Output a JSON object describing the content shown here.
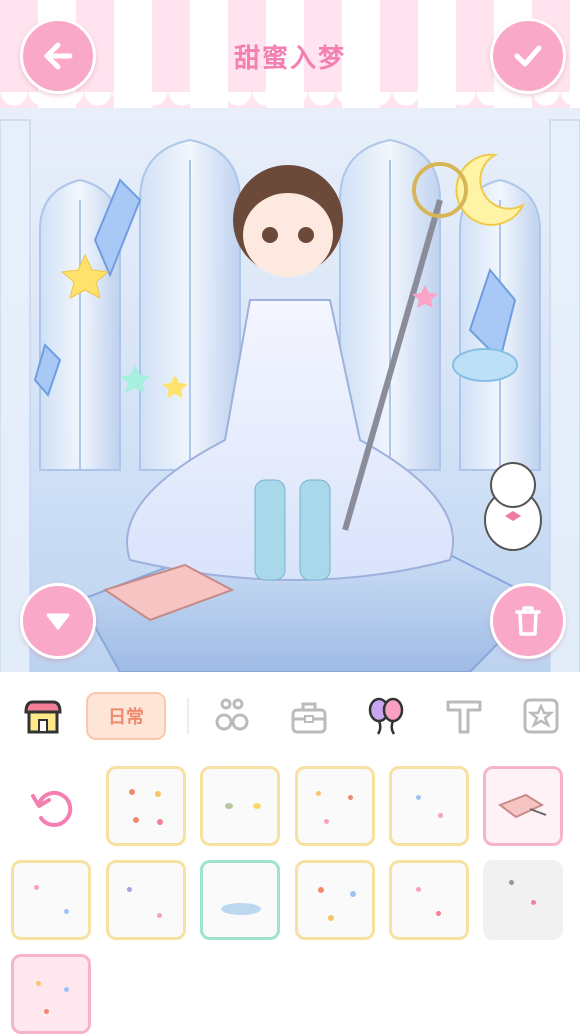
{
  "header": {
    "title": "甜蜜入梦",
    "back_icon": "arrow-left-icon",
    "confirm_icon": "check-icon"
  },
  "scene": {
    "collapse_icon": "triangle-down-icon",
    "delete_icon": "trash-icon"
  },
  "toolbar": {
    "shop_icon": "shop-icon",
    "daily_tab_label": "日常",
    "tabs": [
      {
        "icon": "flower-accessory-icon"
      },
      {
        "icon": "bag-icon"
      },
      {
        "icon": "balloon-icon"
      },
      {
        "icon": "text-t-icon"
      },
      {
        "icon": "star-frame-icon"
      }
    ]
  },
  "items": {
    "reset_icon": "reset-icon",
    "grid": [
      {
        "style": "yellow"
      },
      {
        "style": "yellow"
      },
      {
        "style": "yellow"
      },
      {
        "style": "yellow"
      },
      {
        "style": "pink-selected"
      },
      {
        "style": "yellow"
      },
      {
        "style": "yellow"
      },
      {
        "style": "green"
      },
      {
        "style": "yellow"
      },
      {
        "style": "yellow"
      },
      {
        "style": "gray"
      },
      {
        "style": "pink"
      }
    ]
  },
  "colors": {
    "accent_pink": "#f9a8c8",
    "title_pink": "#f47fb0",
    "daily_tab_bg": "#fde6d8"
  }
}
